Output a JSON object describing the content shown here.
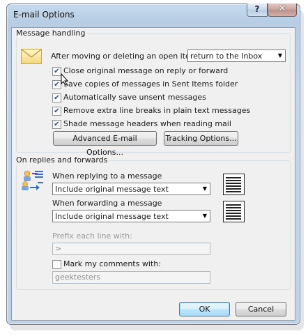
{
  "window": {
    "title": "E-mail Options",
    "help_glyph": "?",
    "close_glyph": "✕"
  },
  "message_handling": {
    "group_title": "Message handling",
    "after_moving_label": "After moving or deleting an open item:",
    "after_moving_value": "return to the Inbox",
    "checkboxes": [
      {
        "label": "Close original message on reply or forward",
        "checked": true
      },
      {
        "label": "Save copies of messages in Sent Items folder",
        "checked": true
      },
      {
        "label": "Automatically save unsent messages",
        "checked": true
      },
      {
        "label": "Remove extra line breaks in plain text messages",
        "checked": true
      },
      {
        "label": "Shade message headers when reading mail",
        "checked": true
      }
    ],
    "advanced_button": "Advanced E-mail Options...",
    "tracking_button": "Tracking Options..."
  },
  "replies": {
    "group_title": "On replies and forwards",
    "replying_label": "When replying to a message",
    "replying_value": "Include original message text",
    "forwarding_label": "When forwarding a message",
    "forwarding_value": "Include original message text",
    "prefix_label": "Prefix each line with:",
    "prefix_value": ">",
    "mark_comments_label": "Mark my comments with:",
    "mark_comments_checked": false,
    "mark_comments_value": "geektesters"
  },
  "footer": {
    "ok_label": "OK",
    "cancel_label": "Cancel"
  },
  "icons": {
    "envelope": "envelope-icon",
    "reply_forward": "reply-forward-icon",
    "reply_preview": "document-preview-icon",
    "forward_preview": "document-preview-icon"
  },
  "colors": {
    "window_frame": "#b7cde4",
    "client_bg": "#f0f0f0",
    "default_button": "#a7d9f5"
  }
}
